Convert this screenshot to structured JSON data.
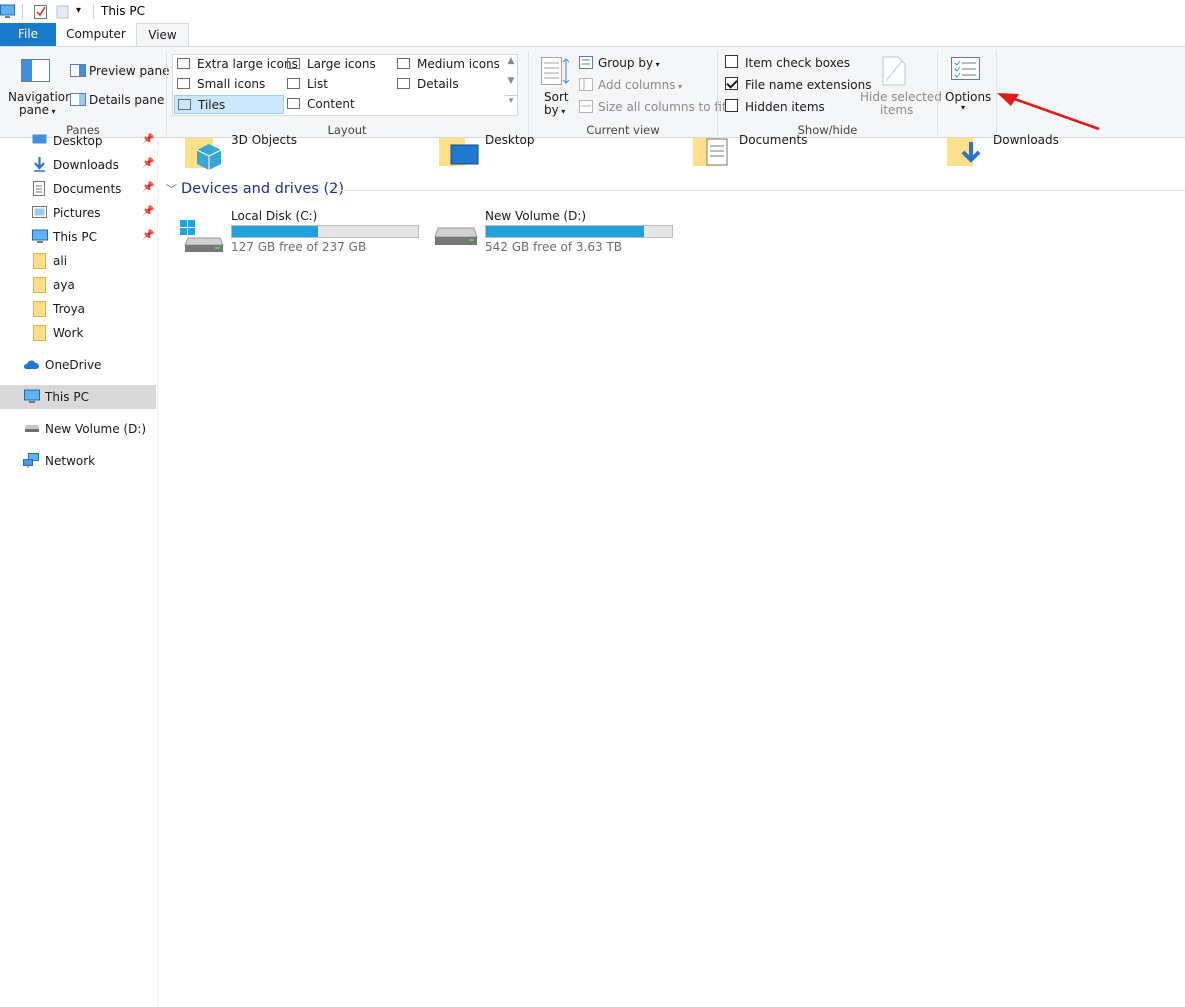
{
  "window": {
    "title": "This PC"
  },
  "tabs": [
    {
      "label": "File"
    },
    {
      "label": "Computer"
    },
    {
      "label": "View"
    }
  ],
  "ribbon": {
    "panes": {
      "navigation_pane": "Navigation",
      "navigation_pane_2": "pane",
      "preview_pane": "Preview pane",
      "details_pane": "Details pane",
      "group_label": "Panes"
    },
    "layout": {
      "items": [
        "Extra large icons",
        "Large icons",
        "Medium icons",
        "Small icons",
        "List",
        "Details",
        "Tiles",
        "Content"
      ],
      "selected": "Tiles",
      "group_label": "Layout"
    },
    "current_view": {
      "sort_by": "Sort",
      "sort_by_2": "by",
      "group_by": "Group by",
      "add_columns": "Add columns",
      "size_columns": "Size all columns to fit",
      "group_label": "Current view"
    },
    "show_hide": {
      "item_check_boxes": "Item check boxes",
      "item_check_boxes_checked": false,
      "file_name_extensions": "File name extensions",
      "file_name_extensions_checked": true,
      "hidden_items": "Hidden items",
      "hidden_items_checked": false,
      "hide_selected": "Hide selected",
      "hide_selected_2": "items",
      "group_label": "Show/hide"
    },
    "options": {
      "label": "Options"
    }
  },
  "nav": {
    "items": [
      {
        "label": "Desktop",
        "icon": "desktop-icon",
        "pinned": true
      },
      {
        "label": "Downloads",
        "icon": "downloads-icon",
        "pinned": true
      },
      {
        "label": "Documents",
        "icon": "documents-icon",
        "pinned": true
      },
      {
        "label": "Pictures",
        "icon": "pictures-icon",
        "pinned": true
      },
      {
        "label": "This PC",
        "icon": "this-pc-icon",
        "pinned": true
      },
      {
        "label": "ali",
        "icon": "folder-icon"
      },
      {
        "label": "aya",
        "icon": "folder-icon"
      },
      {
        "label": "Troya",
        "icon": "folder-icon"
      },
      {
        "label": "Work",
        "icon": "folder-icon"
      },
      {
        "label": "OneDrive",
        "icon": "onedrive-icon"
      },
      {
        "label": "This PC",
        "icon": "this-pc-icon",
        "selected": true
      },
      {
        "label": "New Volume (D:)",
        "icon": "drive-icon"
      },
      {
        "label": "Network",
        "icon": "network-icon"
      }
    ]
  },
  "main": {
    "folders": [
      {
        "label": "3D Objects",
        "icon": "3d-objects-folder-icon"
      },
      {
        "label": "Desktop",
        "icon": "desktop-folder-icon"
      },
      {
        "label": "Documents",
        "icon": "documents-folder-icon"
      },
      {
        "label": "Downloads",
        "icon": "downloads-folder-icon"
      }
    ],
    "devices_header": "Devices and drives (2)",
    "drives": [
      {
        "name": "Local Disk (C:)",
        "free": "127 GB free of 237 GB",
        "used_fraction": 0.46,
        "icon": "windows-drive-icon"
      },
      {
        "name": "New Volume (D:)",
        "free": "542 GB free of 3.63 TB",
        "used_fraction": 0.85,
        "icon": "hard-drive-icon"
      }
    ]
  },
  "colors": {
    "file_tab": "#1979ca",
    "usage_bar": "#26a0da",
    "arrow": "#e11b1b",
    "section_header": "#1e3287"
  }
}
